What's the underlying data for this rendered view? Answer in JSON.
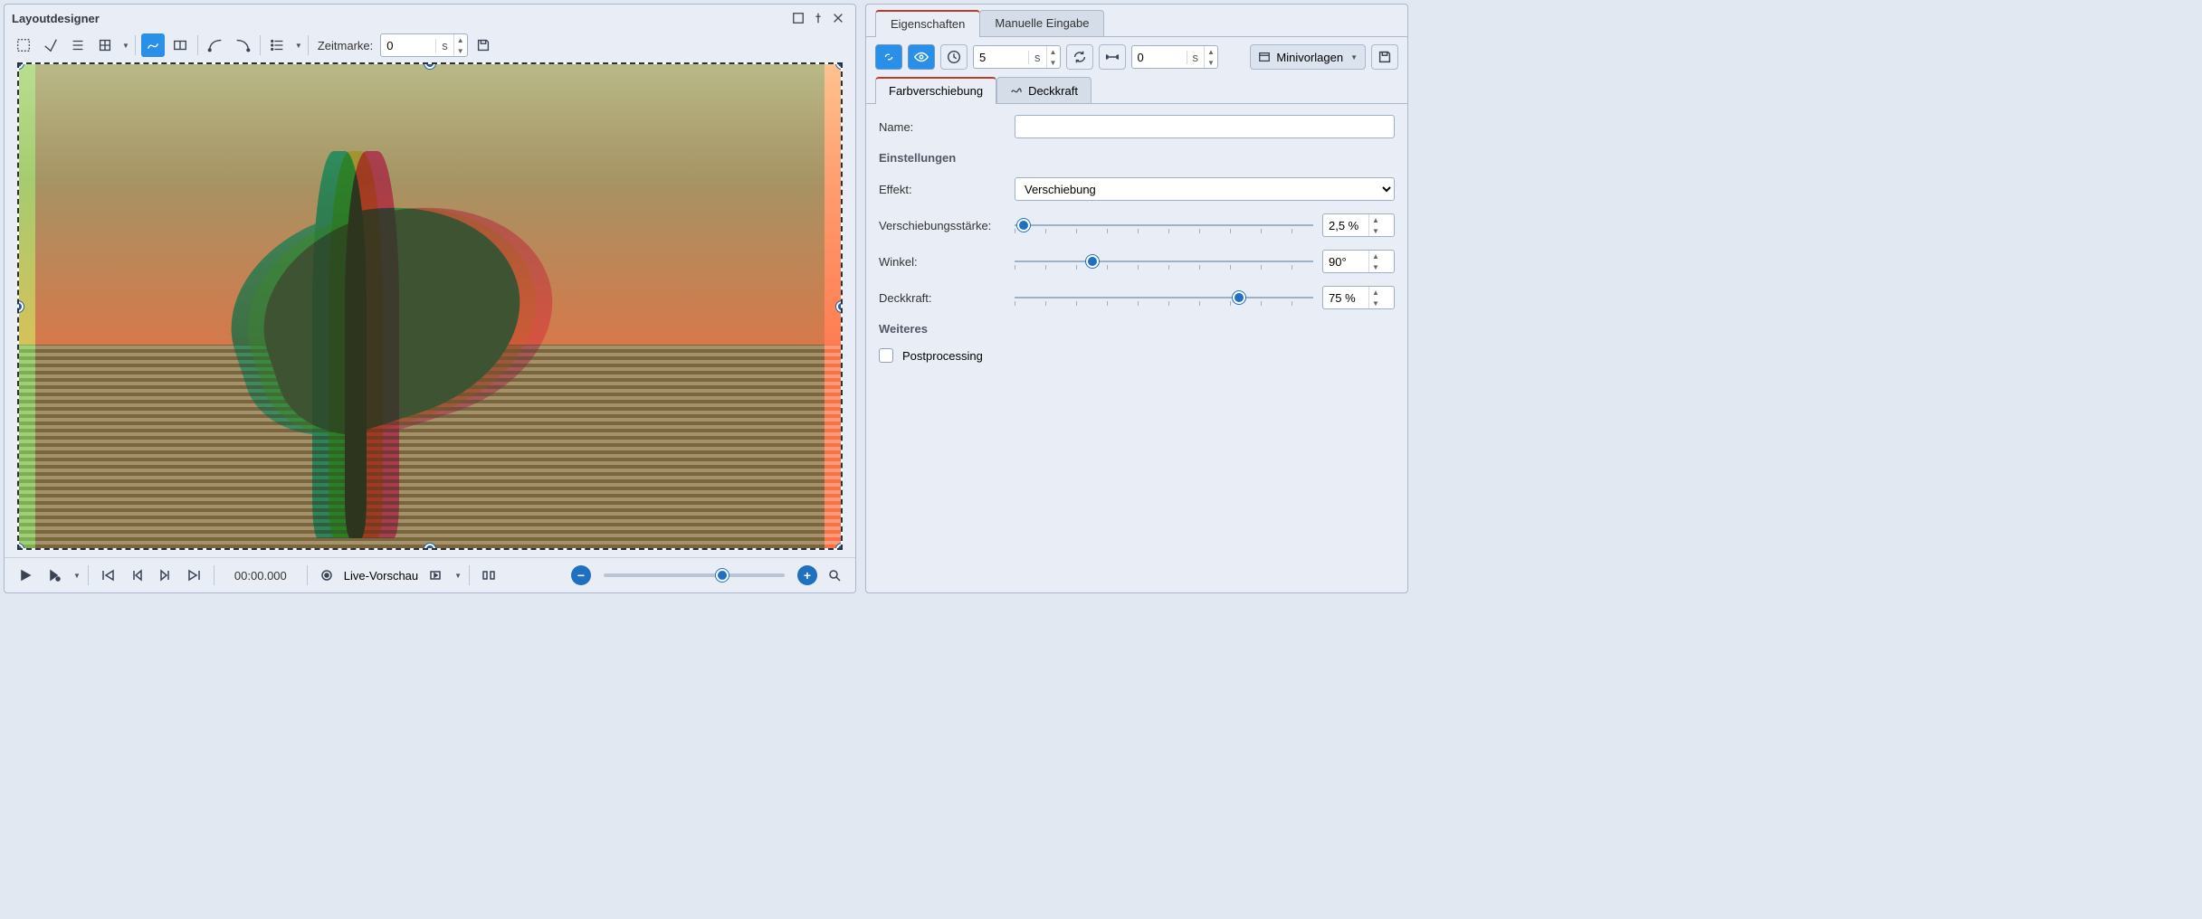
{
  "window": {
    "title": "Layoutdesigner"
  },
  "toolbar": {
    "timemark_label": "Zeitmarke:",
    "timemark_value": "0",
    "timemark_unit": "s"
  },
  "playback": {
    "time": "00:00.000",
    "live_preview_label": "Live-Vorschau"
  },
  "props": {
    "top_tabs": {
      "eigenschaften": "Eigenschaften",
      "manuelle": "Manuelle Eingabe"
    },
    "duration_value": "5",
    "duration_unit": "s",
    "offset_value": "0",
    "offset_unit": "s",
    "minivorlagen": "Minivorlagen",
    "sub_tabs": {
      "farbverschiebung": "Farbverschiebung",
      "deckkraft": "Deckkraft"
    },
    "name_label": "Name:",
    "name_value": "",
    "section_einstellungen": "Einstellungen",
    "effekt_label": "Effekt:",
    "effekt_value": "Verschiebung",
    "verschiebung_label": "Verschiebungsstärke:",
    "verschiebung_value": "2,5 %",
    "winkel_label": "Winkel:",
    "winkel_value": "90°",
    "deckkraft_label": "Deckkraft:",
    "deckkraft_value": "75 %",
    "section_weiteres": "Weiteres",
    "postprocessing_label": "Postprocessing"
  }
}
